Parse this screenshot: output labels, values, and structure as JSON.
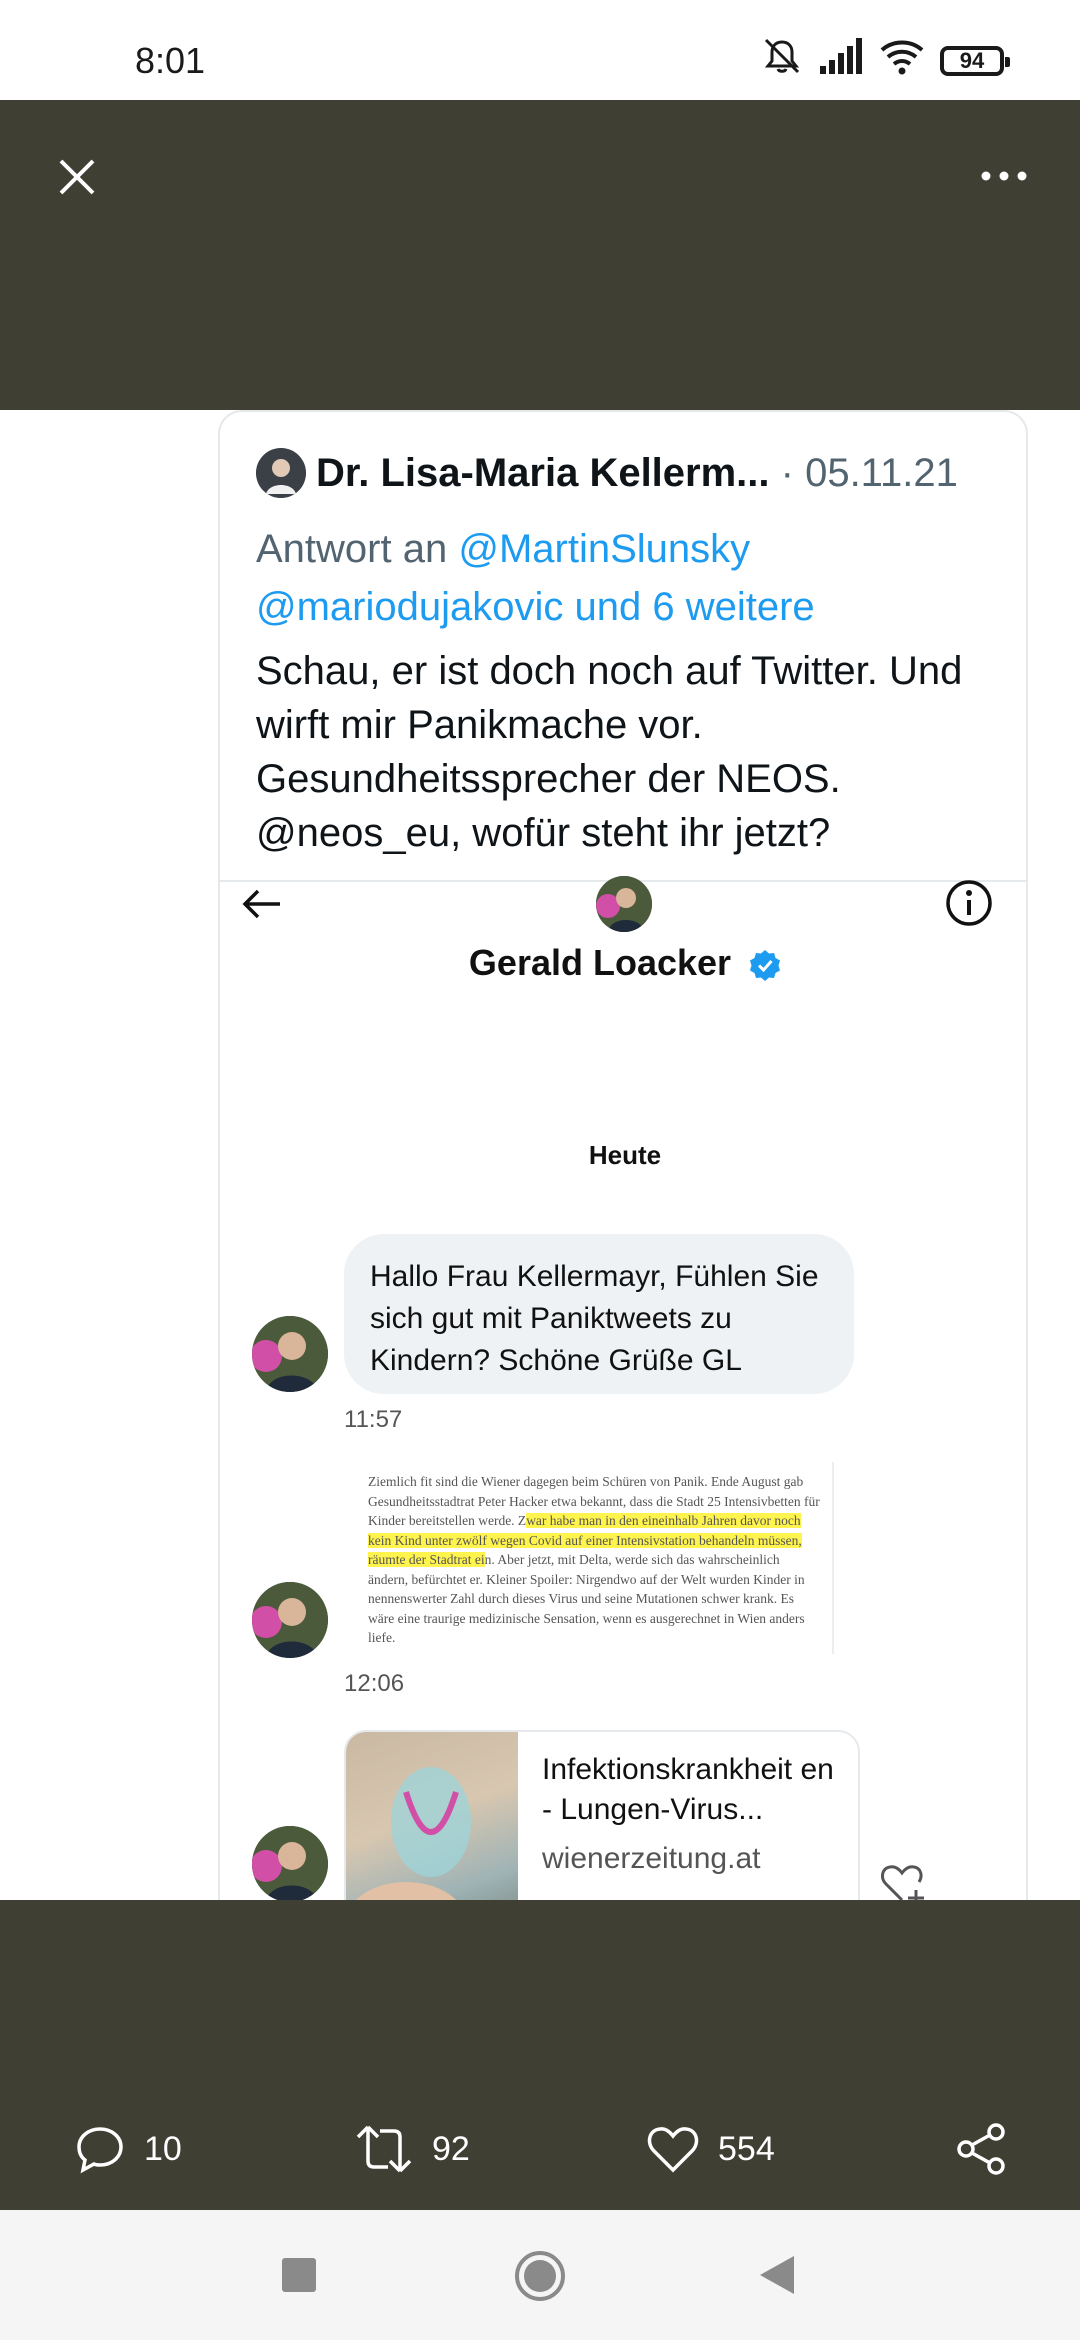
{
  "status_bar": {
    "time": "8:01",
    "battery": "94"
  },
  "tweet": {
    "author_name": "Dr. Lisa-Maria Kellerm...",
    "date": "· 05.11.21",
    "reply_prefix": "Antwort an",
    "reply_user": "@MartinSlunsky",
    "reply_user2": "@mariodujakovic",
    "reply_more": "und 6 weitere",
    "text": "Schau, er ist doch noch auf Twitter. Und wirft mir Panikmache vor. Gesundheitssprecher der NEOS. @neos_eu, wofür steht ihr jetzt?"
  },
  "dm": {
    "contact_name": "Gerald Loacker",
    "day_label": "Heute",
    "message1": "Hallo Frau Kellermayr, Fühlen Sie sich gut mit Paniktweets zu Kindern?  Schöne Grüße GL",
    "time1": "11:57",
    "clip_text_pre": "Ziemlich fit sind die Wiener dagegen beim Schüren von Panik. Ende August gab Gesundheitsstadtrat Peter Hacker etwa bekannt, dass die Stadt 25 Intensivbetten für Kinder bereitstellen werde. Z",
    "clip_text_hl": "war habe man in den eineinhalb Jahren davor noch kein Kind unter zwölf wegen Covid auf einer Intensivstation behandeln müssen, räumte der Stadtrat ei",
    "clip_text_post": "n. Aber jetzt, mit Delta, werde sich das wahrscheinlich ändern, befürchtet er. Kleiner Spoiler: Nirgendwo auf der Welt wurden Kinder in nennenswerter Zahl durch dieses Virus und seine Mutationen schwer krank. Es wäre eine traurige medizinische Sensation, wenn es ausgerechnet in Wien anders liefe.",
    "time2": "12:06",
    "link_title": "Infektionskrankheit en - Lungen-Virus...",
    "link_domain": "wienerzeitung.at"
  },
  "actions": {
    "replies": "10",
    "retweets": "92",
    "likes": "554"
  },
  "icons": [
    "close-icon",
    "more-icon",
    "back-arrow-icon",
    "info-icon",
    "verified-badge-icon",
    "add-reaction-icon",
    "reply-icon",
    "retweet-icon",
    "like-icon",
    "share-icon",
    "recents-icon",
    "home-icon",
    "back-icon"
  ],
  "colors": {
    "media_bg": "#3f3f33",
    "link": "#1d9bf0",
    "secondary_text": "#536471"
  }
}
